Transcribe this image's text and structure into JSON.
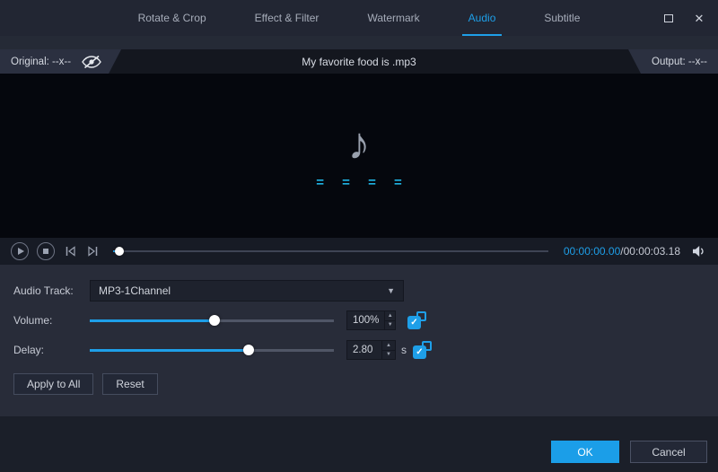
{
  "window": {
    "close_glyph": "✕"
  },
  "tabs": [
    {
      "label": "Rotate & Crop"
    },
    {
      "label": "Effect & Filter"
    },
    {
      "label": "Watermark"
    },
    {
      "label": "Audio"
    },
    {
      "label": "Subtitle"
    }
  ],
  "info_bar": {
    "original_label": "Original: --x--",
    "title": "My favorite food is .mp3",
    "output_label": "Output: --x--"
  },
  "preview": {
    "note_glyph": "♪",
    "equalizer_text": "= = = ="
  },
  "playback": {
    "current_time": "00:00:00.00",
    "total_time": "/00:00:03.18",
    "progress_percent": 1.5
  },
  "controls": {
    "audio_track": {
      "label": "Audio Track:",
      "value": "MP3-1Channel"
    },
    "volume": {
      "label": "Volume:",
      "value": "100%",
      "percent": 51
    },
    "delay": {
      "label": "Delay:",
      "value": "2.80",
      "unit": "s",
      "percent": 65
    },
    "apply_all_label": "Apply to All",
    "reset_label": "Reset"
  },
  "footer": {
    "ok_label": "OK",
    "cancel_label": "Cancel"
  },
  "icons": {
    "dropdown_arrow": "▼",
    "spinner_up": "▲",
    "spinner_down": "▼",
    "check": "✓"
  },
  "colors": {
    "accent": "#1e9fe8",
    "equalizer": "#1fb2e2"
  }
}
